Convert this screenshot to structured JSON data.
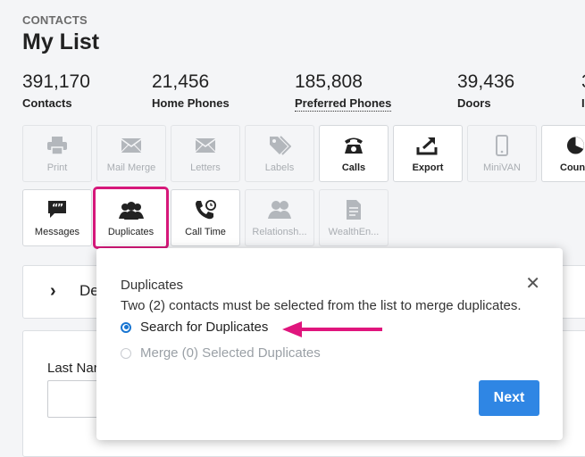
{
  "header": {
    "section": "CONTACTS",
    "title": "My List"
  },
  "stats": [
    {
      "value": "391,170",
      "label": "Contacts"
    },
    {
      "value": "21,456",
      "label": "Home Phones"
    },
    {
      "value": "185,808",
      "label": "Preferred Phones"
    },
    {
      "value": "39,436",
      "label": "Doors"
    }
  ],
  "toolbar": {
    "row1": [
      {
        "label": "Print",
        "icon": "printer-icon",
        "enabled": false
      },
      {
        "label": "Mail Merge",
        "icon": "envelope-icon",
        "enabled": false
      },
      {
        "label": "Letters",
        "icon": "envelope-icon",
        "enabled": false
      },
      {
        "label": "Labels",
        "icon": "tags-icon",
        "enabled": false
      },
      {
        "label": "Calls",
        "icon": "phone-icon",
        "enabled": true
      },
      {
        "label": "Export",
        "icon": "export-icon",
        "enabled": true
      },
      {
        "label": "MiniVAN",
        "icon": "mobile-phone-icon",
        "enabled": false
      },
      {
        "label": "Coun",
        "icon": "pie-chart-icon",
        "enabled": true
      }
    ],
    "row2": [
      {
        "label": "Messages",
        "icon": "message-quote-icon",
        "enabled": true
      },
      {
        "label": "Duplicates",
        "icon": "people-group-icon",
        "enabled": true,
        "selected": true
      },
      {
        "label": "Call Time",
        "icon": "phone-clock-icon",
        "enabled": true
      },
      {
        "label": "Relationsh...",
        "icon": "people-icon",
        "enabled": false
      },
      {
        "label": "WealthEn...",
        "icon": "document-icon",
        "enabled": false
      }
    ]
  },
  "background": {
    "collapsed_label": "De",
    "field_label": "Last Nar"
  },
  "modal": {
    "title": "Duplicates",
    "message": "Two (2) contacts must be selected from the list to merge duplicates.",
    "option_search": "Search for Duplicates",
    "option_merge": "Merge (0) Selected Duplicates",
    "selected_option": "Search for Duplicates",
    "next_label": "Next",
    "close_glyph": "✕"
  },
  "colors": {
    "accent_pink": "#d6187a",
    "primary_blue": "#2f86e4"
  }
}
